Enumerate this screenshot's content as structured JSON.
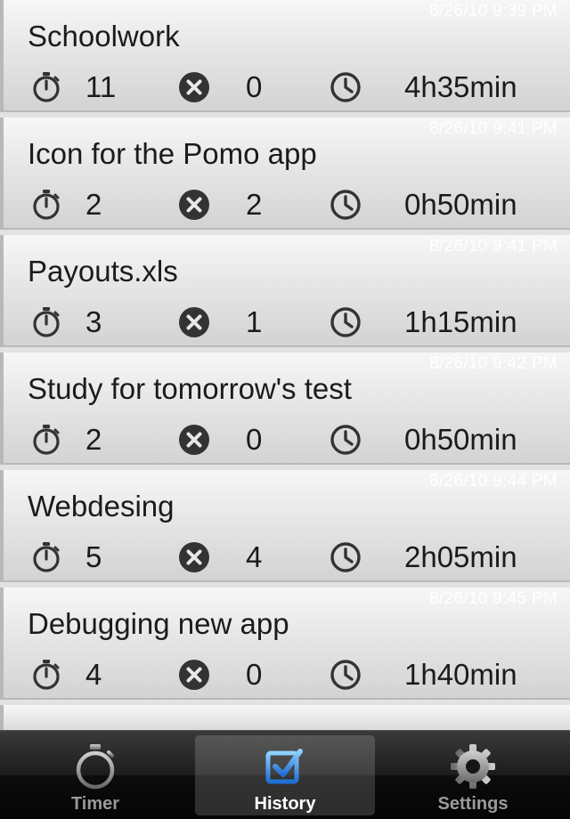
{
  "history": [
    {
      "date": "8/26/10 9:39 PM",
      "title": "Schoolwork",
      "pomodoros": "11",
      "interruptions": "0",
      "duration": "4h35min"
    },
    {
      "date": "8/26/10 9:41 PM",
      "title": "Icon for the Pomo app",
      "pomodoros": "2",
      "interruptions": "2",
      "duration": "0h50min"
    },
    {
      "date": "8/26/10 9:41 PM",
      "title": "Payouts.xls",
      "pomodoros": "3",
      "interruptions": "1",
      "duration": "1h15min"
    },
    {
      "date": "8/26/10 9:42 PM",
      "title": "Study for tomorrow's test",
      "pomodoros": "2",
      "interruptions": "0",
      "duration": "0h50min"
    },
    {
      "date": "8/26/10 9:44 PM",
      "title": "Webdesing",
      "pomodoros": "5",
      "interruptions": "4",
      "duration": "2h05min"
    },
    {
      "date": "8/26/10 9:45 PM",
      "title": "Debugging new app",
      "pomodoros": "4",
      "interruptions": "0",
      "duration": "1h40min"
    }
  ],
  "tabbar": {
    "tabs": [
      {
        "label": "Timer",
        "icon": "stopwatch-icon"
      },
      {
        "label": "History",
        "icon": "checkbox-icon",
        "selected": true
      },
      {
        "label": "Settings",
        "icon": "gear-icon"
      }
    ]
  },
  "colors": {
    "tab_selected_icon": "#3a8ee6",
    "icon_dark": "#333333",
    "date_text": "#ffffff"
  }
}
